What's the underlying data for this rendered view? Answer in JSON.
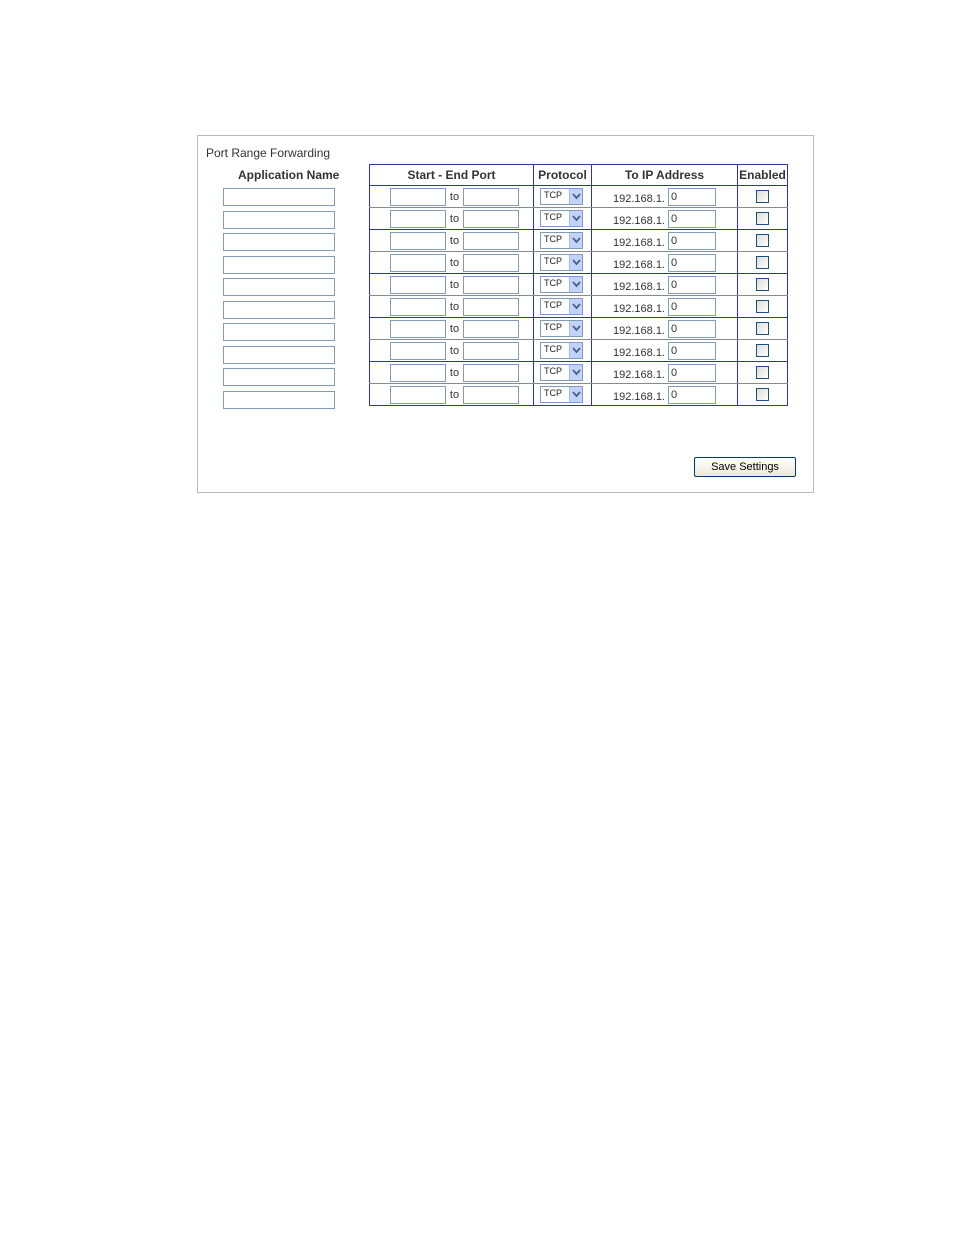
{
  "panel": {
    "title": "Port Range Forwarding",
    "columns": {
      "application_name": "Application Name",
      "start_end_port": "Start - End Port",
      "protocol": "Protocol",
      "to_ip_address": "To IP Address",
      "enabled": "Enabled"
    },
    "port_separator": "to",
    "ip_prefix": "192.168.1.",
    "rows": [
      {
        "app_name": "",
        "start_port": "",
        "end_port": "",
        "protocol": "TCP",
        "ip_last_octet": "0",
        "enabled": false
      },
      {
        "app_name": "",
        "start_port": "",
        "end_port": "",
        "protocol": "TCP",
        "ip_last_octet": "0",
        "enabled": false
      },
      {
        "app_name": "",
        "start_port": "",
        "end_port": "",
        "protocol": "TCP",
        "ip_last_octet": "0",
        "enabled": false
      },
      {
        "app_name": "",
        "start_port": "",
        "end_port": "",
        "protocol": "TCP",
        "ip_last_octet": "0",
        "enabled": false
      },
      {
        "app_name": "",
        "start_port": "",
        "end_port": "",
        "protocol": "TCP",
        "ip_last_octet": "0",
        "enabled": false
      },
      {
        "app_name": "",
        "start_port": "",
        "end_port": "",
        "protocol": "TCP",
        "ip_last_octet": "0",
        "enabled": false
      },
      {
        "app_name": "",
        "start_port": "",
        "end_port": "",
        "protocol": "TCP",
        "ip_last_octet": "0",
        "enabled": false
      },
      {
        "app_name": "",
        "start_port": "",
        "end_port": "",
        "protocol": "TCP",
        "ip_last_octet": "0",
        "enabled": false
      },
      {
        "app_name": "",
        "start_port": "",
        "end_port": "",
        "protocol": "TCP",
        "ip_last_octet": "0",
        "enabled": false
      },
      {
        "app_name": "",
        "start_port": "",
        "end_port": "",
        "protocol": "TCP",
        "ip_last_octet": "0",
        "enabled": false
      }
    ],
    "save_label": "Save Settings"
  },
  "colors": {
    "table_border": "#2b3a8c",
    "input_border": "#7f9db9",
    "dropdown_button": "#c3d3fd"
  },
  "icons": {
    "dropdown": "chevron-down-icon"
  }
}
